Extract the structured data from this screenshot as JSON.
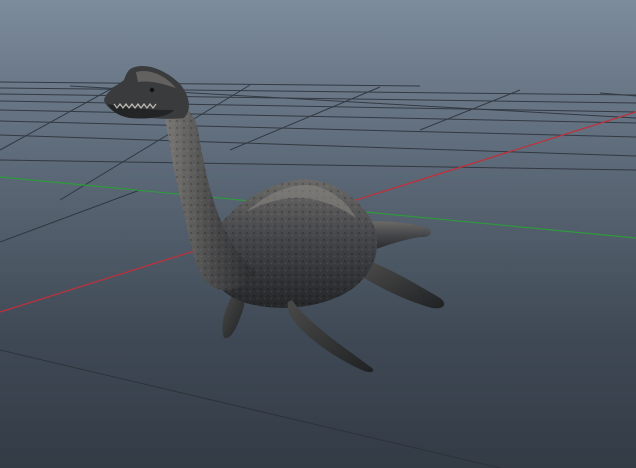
{
  "viewport": {
    "background_top": "#7d8c9d",
    "background_bottom": "#333b45"
  },
  "grid": {
    "line_color": "#2a3038",
    "x_axis_color": "#c0303a",
    "z_axis_color": "#2f9a3c"
  },
  "model": {
    "subject": "plesiosaur-creature",
    "skin_dark": "#2b2d2f",
    "skin_mid": "#5a5a58",
    "skin_light": "#8a8884"
  }
}
